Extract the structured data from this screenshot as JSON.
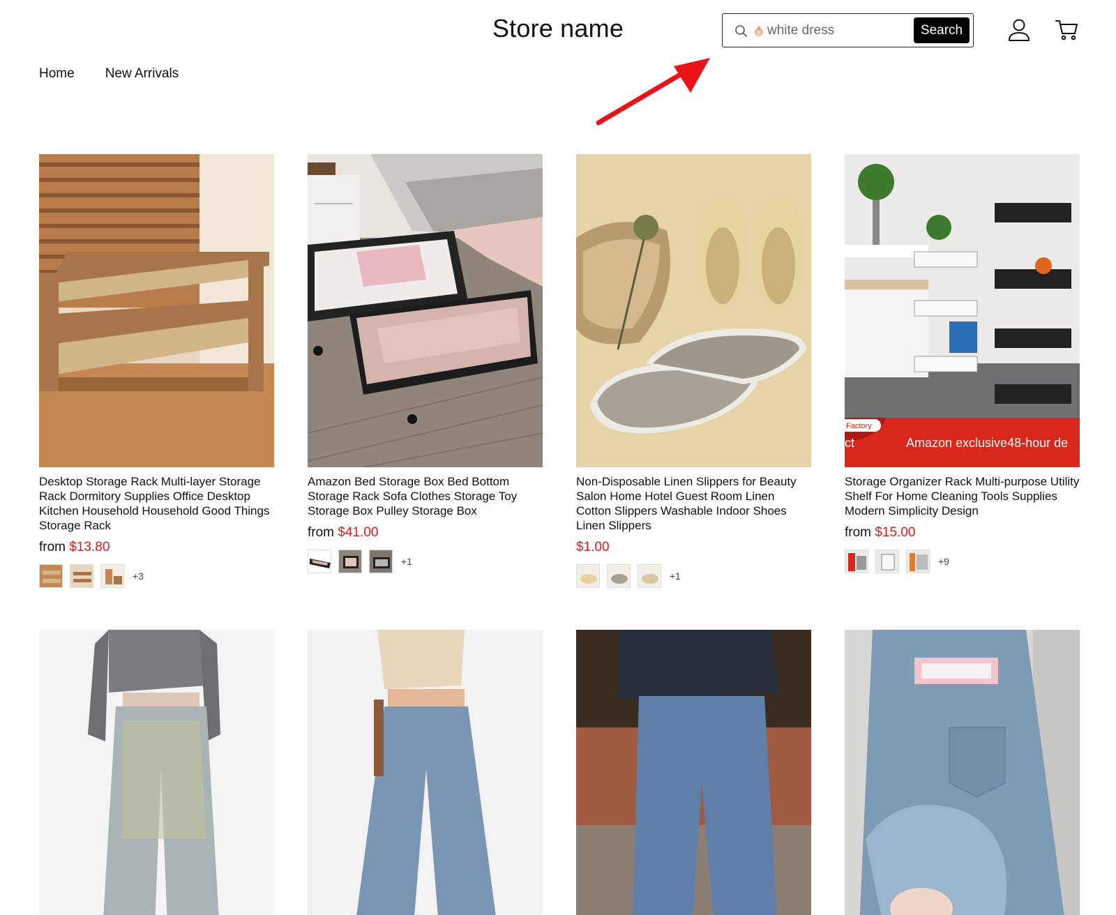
{
  "header": {
    "store_name": "Store name",
    "search": {
      "value": "white dress",
      "button_label": "Search"
    }
  },
  "nav": {
    "items": [
      "Home",
      "New Arrivals"
    ]
  },
  "products": [
    {
      "title": "Desktop Storage Rack Multi-layer Storage Rack Dormitory Supplies Office Desktop Kitchen Household Household Good Things Storage Rack",
      "price_prefix": "from",
      "price": "$13.80",
      "more_variants": "+3"
    },
    {
      "title": "Amazon Bed Storage Box Bed Bottom Storage Rack Sofa Clothes Storage Toy Storage Box Pulley Storage Box",
      "price_prefix": "from",
      "price": "$41.00",
      "more_variants": "+1"
    },
    {
      "title": "Non-Disposable Linen Slippers for Beauty Salon Home Hotel Guest Room Linen Cotton Slippers Washable Indoor Shoes Linen Slippers",
      "price_prefix": "",
      "price": "$1.00",
      "more_variants": "+1"
    },
    {
      "title": "Storage Organizer Rack Multi-purpose Utility Shelf For Home Cleaning Tools Supplies Modern Simplicity Design",
      "price_prefix": "from",
      "price": "$15.00",
      "more_variants": "+9",
      "image_banner": {
        "tag": "Factory",
        "side_text": "ct\ns",
        "text": "Amazon exclusive48-hour de"
      }
    },
    {
      "title": "",
      "price": ""
    },
    {
      "title": "",
      "price": ""
    },
    {
      "title": "",
      "price": ""
    },
    {
      "title": "",
      "price": ""
    }
  ],
  "colors": {
    "price": "#e31b1b",
    "annotation_arrow": "#e8141a",
    "button_bg": "#000000"
  }
}
